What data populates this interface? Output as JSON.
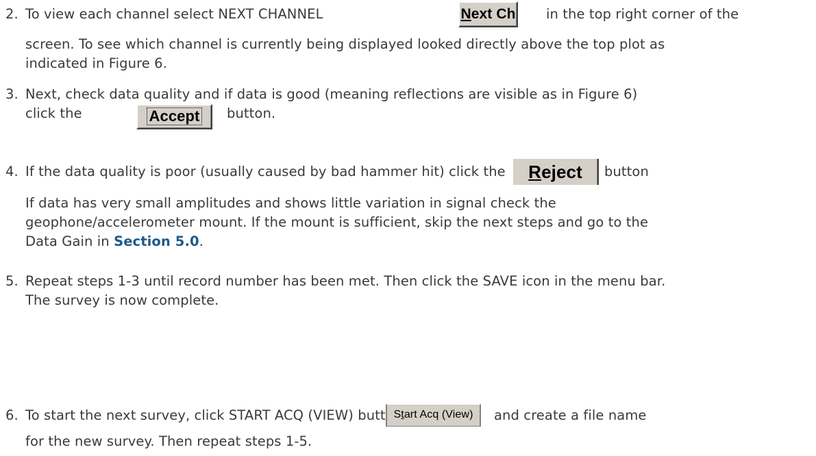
{
  "steps": [
    {
      "number": "2.",
      "line1_before": "To view each channel select NEXT CHANNEL",
      "line1_after": "in the top right corner of the",
      "button_label_first": "N",
      "button_label_rest": "ext Ch",
      "line2": "screen. To see which channel is currently being displayed looked directly above the top plot as",
      "line3": "indicated in Figure 6."
    },
    {
      "number": "3.",
      "line1": "Next, check data quality and if data is good (meaning reflections are visible as in Figure 6)",
      "line2_before": "click the",
      "button_label": "Accept",
      "line2_after": "button."
    },
    {
      "number": "4.",
      "line1_before": "If the data quality is poor (usually caused by bad hammer hit) click the",
      "button_label_first": "R",
      "button_label_rest": "eject",
      "line1_after": "button",
      "para_line1": "If data has very small amplitudes and shows little variation in signal check the",
      "para_line2": "geophone/accelerometer mount. If the mount is sufficient, skip the next steps and go to the",
      "para_line3_before": "Data Gain in ",
      "section_ref": "Section 5.0",
      "para_line3_after": "."
    },
    {
      "number": "5.",
      "line1": "Repeat steps 1-3 until record number has been met. Then click the SAVE icon in the menu bar.",
      "line2": "The survey is now complete."
    },
    {
      "number": "6.",
      "line1_before": "To start the next survey, click START ACQ (VIEW) button",
      "button_label_first": "S",
      "button_label_underlined": "t",
      "button_label_rest": "art Acq (View)",
      "line1_after": "and create a file name",
      "line2": "for the new survey. Then repeat steps 1-5."
    }
  ]
}
